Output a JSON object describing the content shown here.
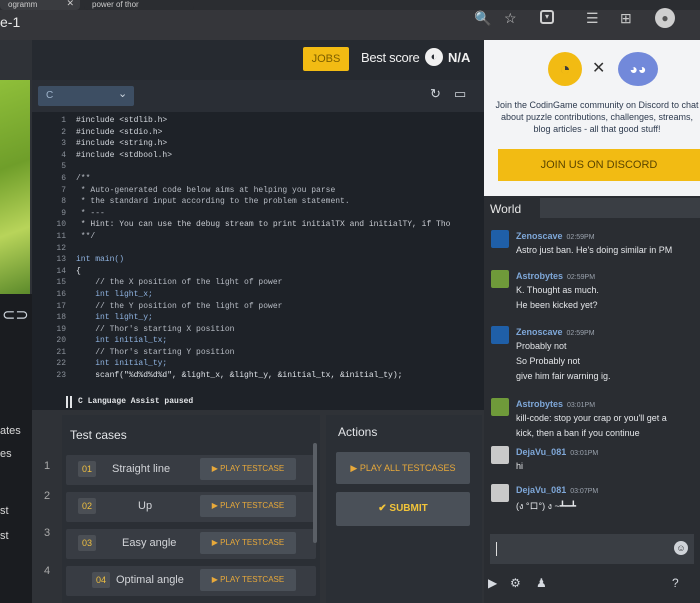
{
  "browser": {
    "tab1": "ogramm",
    "tab2": "power of thor",
    "address_fragment": "e-1"
  },
  "left": {
    "labels": [
      "ates",
      "es",
      "st",
      "st"
    ],
    "tick_labels": [
      "1",
      "2",
      "3",
      "4"
    ]
  },
  "topbar": {
    "jobs_label": "JOBS",
    "best_score_label": "Best score",
    "best_score_value": "N/A"
  },
  "editor": {
    "language": "C",
    "status": "C Language Assist paused",
    "lines": [
      {
        "n": "1",
        "text": "#include <stdlib.h>",
        "cls": "c-pre"
      },
      {
        "n": "2",
        "text": "#include <stdio.h>",
        "cls": "c-pre"
      },
      {
        "n": "3",
        "text": "#include <string.h>",
        "cls": "c-pre"
      },
      {
        "n": "4",
        "text": "#include <stdbool.h>",
        "cls": "c-pre"
      },
      {
        "n": "5",
        "text": "",
        "cls": "c-txt"
      },
      {
        "n": "6",
        "text": "/**",
        "cls": "c-com"
      },
      {
        "n": "7",
        "text": " * Auto-generated code below aims at helping you parse",
        "cls": "c-com"
      },
      {
        "n": "8",
        "text": " * the standard input according to the problem statement.",
        "cls": "c-com"
      },
      {
        "n": "9",
        "text": " * ---",
        "cls": "c-com"
      },
      {
        "n": "10",
        "text": " * Hint: You can use the debug stream to print initialTX and initialTY, if Tho",
        "cls": "c-hint"
      },
      {
        "n": "11",
        "text": " **/",
        "cls": "c-com"
      },
      {
        "n": "12",
        "text": "",
        "cls": "c-txt"
      },
      {
        "n": "13",
        "text": "int main()",
        "cls": "c-kw"
      },
      {
        "n": "14",
        "text": "{",
        "cls": "c-txt"
      },
      {
        "n": "15",
        "text": "    // the X position of the light of power",
        "cls": "c-com"
      },
      {
        "n": "16",
        "text": "    int light_x;",
        "cls": "c-kw"
      },
      {
        "n": "17",
        "text": "    // the Y position of the light of power",
        "cls": "c-com"
      },
      {
        "n": "18",
        "text": "    int light_y;",
        "cls": "c-kw"
      },
      {
        "n": "19",
        "text": "    // Thor's starting X position",
        "cls": "c-com"
      },
      {
        "n": "20",
        "text": "    int initial_tx;",
        "cls": "c-kw"
      },
      {
        "n": "21",
        "text": "    // Thor's starting Y position",
        "cls": "c-com"
      },
      {
        "n": "22",
        "text": "    int initial_ty;",
        "cls": "c-kw"
      },
      {
        "n": "23",
        "text": "    scanf(\"%d%d%d%d\", &light_x, &light_y, &initial_tx, &initial_ty);",
        "cls": "c-txt"
      }
    ]
  },
  "test_cases": {
    "title": "Test cases",
    "items": [
      {
        "num": "01",
        "name": "Straight line",
        "play": "▶ PLAY TESTCASE"
      },
      {
        "num": "02",
        "name": "Up",
        "play": "▶ PLAY TESTCASE"
      },
      {
        "num": "03",
        "name": "Easy angle",
        "play": "▶ PLAY TESTCASE"
      },
      {
        "num": "04",
        "name": "Optimal angle",
        "play": "▶ PLAY TESTCASE"
      }
    ]
  },
  "actions": {
    "title": "Actions",
    "play_all": "▶ PLAY ALL TESTCASES",
    "submit": "✔ SUBMIT"
  },
  "promo": {
    "text": "Join the CodinGame community on Discord to chat about puzzle contributions, challenges, streams, blog articles - all that good stuff!",
    "button": "JOIN US ON DISCORD"
  },
  "chat": {
    "channel": "World",
    "messages": [
      {
        "user": "Zenoscave",
        "time": "02:59PM",
        "lines": [
          "Astro just ban. He's doing similar in PM"
        ],
        "avatar_color": "#1f5fa8"
      },
      {
        "user": "Astrobytes",
        "time": "02:59PM",
        "lines": [
          "K. Thought as much.",
          "He been kicked yet?"
        ],
        "avatar_color": "#6f9a3a"
      },
      {
        "user": "Zenoscave",
        "time": "02:59PM",
        "lines": [
          "Probably not",
          "So Probably not",
          "give him fair warning ig."
        ],
        "avatar_color": "#1f5fa8"
      },
      {
        "user": "Astrobytes",
        "time": "03:01PM",
        "lines": [
          "kill-code: stop your crap or you'll get a",
          "kick, then a ban if you continue"
        ],
        "avatar_color": "#6f9a3a"
      },
      {
        "user": "DejaVu_081",
        "time": "03:01PM",
        "lines": [
          "hi"
        ],
        "avatar_color": "#c9c9c9"
      },
      {
        "user": "DejaVu_081",
        "time": "03:07PM",
        "lines": [
          "(ง °ロ°) ง ~┻━┻"
        ],
        "avatar_color": "#c9c9c9"
      }
    ]
  }
}
